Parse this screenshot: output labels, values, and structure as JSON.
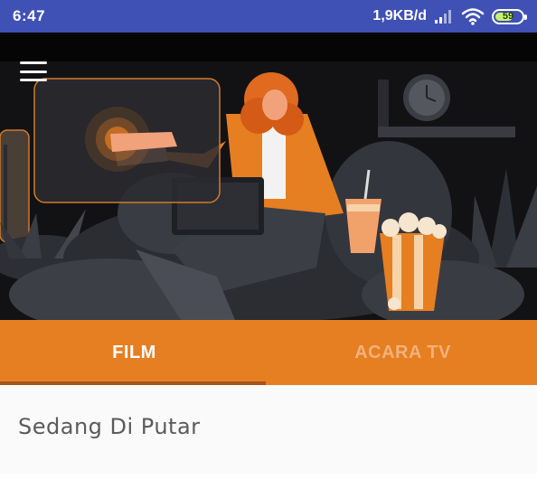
{
  "status_bar": {
    "time": "6:47",
    "network_speed": "1,9KB/d",
    "battery_level": "59",
    "colors": {
      "background": "#3f51b5",
      "battery_fill": "#c6f26a"
    },
    "icons": [
      "signal-icon",
      "wifi-icon",
      "battery-icon"
    ]
  },
  "header": {
    "menu_icon": "hamburger-menu-icon",
    "illustration": "woman-watching-movie-with-popcorn-illustration"
  },
  "tabs": [
    {
      "label": "FILM",
      "active": true
    },
    {
      "label": "ACARA TV",
      "active": false
    }
  ],
  "colors": {
    "accent": "#e67e22",
    "indicator": "#a8511b",
    "hero_background": "#121214"
  },
  "content": {
    "section_title": "Sedang Di Putar"
  }
}
